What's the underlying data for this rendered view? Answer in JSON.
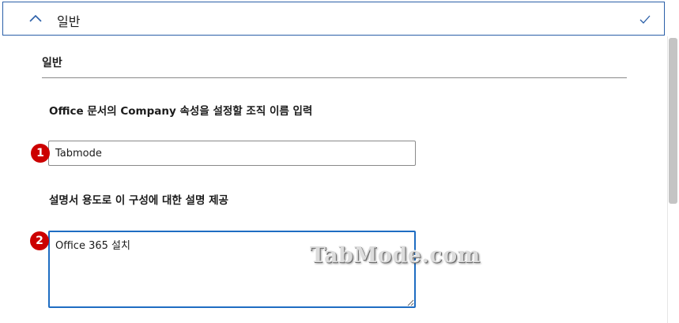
{
  "accordion": {
    "title": "일반",
    "expanded": true,
    "completed": true
  },
  "section": {
    "title": "일반"
  },
  "org_field": {
    "label": "Office 문서의 Company 속성을 설정할 조직 이름 입력",
    "value": "Tabmode"
  },
  "desc_field": {
    "label": "설명서 용도로 이 구성에 대한 설명 제공",
    "value": "Office 365 설치"
  },
  "annotations": {
    "badge1": "1",
    "badge2": "2"
  },
  "watermark": "TabMode.com",
  "colors": {
    "accent": "#1f6dc2",
    "badge": "#cc0000",
    "header_border": "#2b5fa8"
  },
  "icons": {
    "chevron": "chevron-up-icon",
    "check": "checkmark-icon",
    "grip": "resize-grip-icon"
  }
}
